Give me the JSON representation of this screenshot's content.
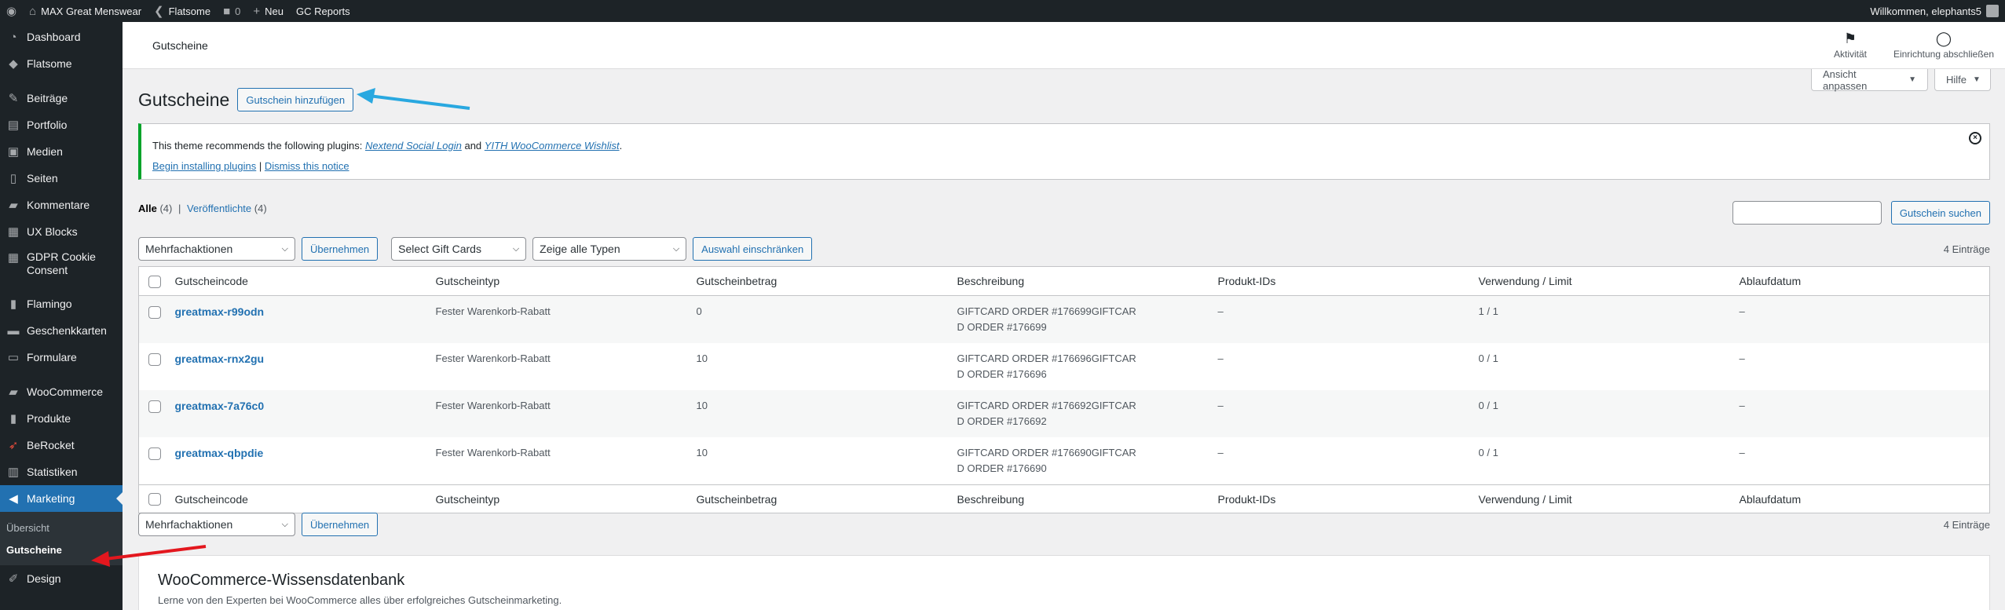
{
  "adminbar": {
    "site_name": "MAX Great Menswear",
    "theme": "Flatsome",
    "comments_count": "0",
    "new_label": "Neu",
    "reports_label": "GC Reports",
    "greeting": "Willkommen, elephants5"
  },
  "sidebar": {
    "items": [
      {
        "label": "Dashboard",
        "icon": "dashboard-icon"
      },
      {
        "label": "Flatsome",
        "icon": "flatsome-icon"
      },
      {
        "label": "Beiträge",
        "icon": "pin-icon"
      },
      {
        "label": "Portfolio",
        "icon": "portfolio-icon"
      },
      {
        "label": "Medien",
        "icon": "media-icon"
      },
      {
        "label": "Seiten",
        "icon": "page-icon"
      },
      {
        "label": "Kommentare",
        "icon": "comment-icon"
      },
      {
        "label": "UX Blocks",
        "icon": "blocks-icon"
      },
      {
        "label": "GDPR Cookie Consent",
        "icon": "cookie-icon"
      },
      {
        "label": "Flamingo",
        "icon": "flamingo-icon"
      },
      {
        "label": "Geschenkkarten",
        "icon": "giftcard-icon"
      },
      {
        "label": "Formulare",
        "icon": "forms-icon"
      },
      {
        "label": "WooCommerce",
        "icon": "woo-icon"
      },
      {
        "label": "Produkte",
        "icon": "products-icon"
      },
      {
        "label": "BeRocket",
        "icon": "rocket-icon"
      },
      {
        "label": "Statistiken",
        "icon": "stats-icon"
      },
      {
        "label": "Marketing",
        "icon": "megaphone-icon"
      },
      {
        "label": "Design",
        "icon": "brush-icon"
      }
    ],
    "submenu": [
      "Übersicht",
      "Gutscheine"
    ]
  },
  "header": {
    "title": "Gutscheine",
    "activity_label": "Aktivität",
    "setup_label": "Einrichtung abschließen",
    "screen_options": "Ansicht anpassen",
    "help": "Hilfe"
  },
  "page": {
    "title": "Gutscheine",
    "add_button": "Gutschein hinzufügen"
  },
  "notice": {
    "text_before": "This theme recommends the following plugins:",
    "plugin1": "Nextend Social Login",
    "and": "and",
    "plugin2": "YITH WooCommerce Wishlist",
    "period": ".",
    "begin_link": "Begin installing plugins",
    "sep": "|",
    "dismiss_link": "Dismiss this notice"
  },
  "views": {
    "all_label": "Alle",
    "all_count": "(4)",
    "published_label": "Veröffentlichte",
    "published_count": "(4)",
    "sep": "|"
  },
  "search": {
    "value": "",
    "button": "Gutschein suchen"
  },
  "tablenav_top": {
    "bulk": "Mehrfachaktionen",
    "apply": "Übernehmen",
    "filter_giftcards": "Select Gift Cards",
    "filter_types": "Zeige alle Typen",
    "filter_button": "Auswahl einschränken",
    "count": "4 Einträge"
  },
  "tablenav_bottom": {
    "bulk": "Mehrfachaktionen",
    "apply": "Übernehmen",
    "count": "4 Einträge"
  },
  "table": {
    "columns": [
      "Gutscheincode",
      "Gutscheintyp",
      "Gutscheinbetrag",
      "Beschreibung",
      "Produkt-IDs",
      "Verwendung / Limit",
      "Ablaufdatum"
    ],
    "rows": [
      {
        "code": "greatmax-r99odn",
        "type": "Fester Warenkorb-Rabatt",
        "amount": "0",
        "description": "GIFTCARD ORDER #176699GIFTCARD ORDER #176699",
        "products": "–",
        "usage": "1 / 1",
        "expiry": "–"
      },
      {
        "code": "greatmax-rnx2gu",
        "type": "Fester Warenkorb-Rabatt",
        "amount": "10",
        "description": "GIFTCARD ORDER #176696GIFTCARD ORDER #176696",
        "products": "–",
        "usage": "0 / 1",
        "expiry": "–"
      },
      {
        "code": "greatmax-7a76c0",
        "type": "Fester Warenkorb-Rabatt",
        "amount": "10",
        "description": "GIFTCARD ORDER #176692GIFTCARD ORDER #176692",
        "products": "–",
        "usage": "0 / 1",
        "expiry": "–"
      },
      {
        "code": "greatmax-qbpdie",
        "type": "Fester Warenkorb-Rabatt",
        "amount": "10",
        "description": "GIFTCARD ORDER #176690GIFTCARD ORDER #176690",
        "products": "–",
        "usage": "0 / 1",
        "expiry": "–"
      }
    ]
  },
  "knowledgebase": {
    "title": "WooCommerce-Wissensdatenbank",
    "text": "Lerne von den Experten bei WooCommerce alles über erfolgreiches Gutscheinmarketing."
  },
  "colors": {
    "admin_dark": "#1d2327",
    "accent_blue": "#2271b1",
    "notice_green": "#00a32a",
    "arrow_blue": "#29a8e0",
    "arrow_red": "#e3171e"
  }
}
